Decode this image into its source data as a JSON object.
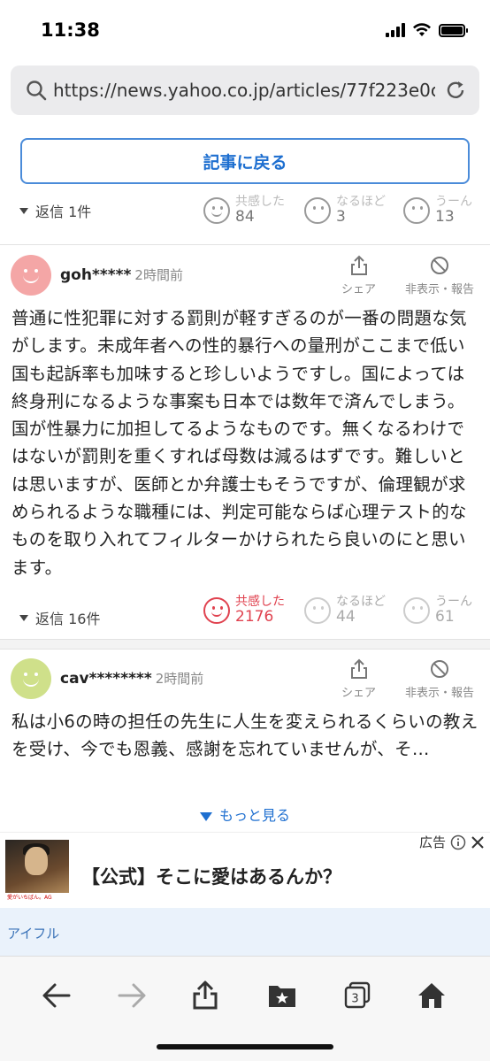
{
  "status": {
    "time": "11:38"
  },
  "url": {
    "text": "https://news.yahoo.co.jp/articles/77f223e0c4..."
  },
  "back_button": {
    "label": "記事に戻る"
  },
  "top_row": {
    "replies": "返信 1件",
    "reactions": [
      {
        "label": "共感した",
        "count": "84"
      },
      {
        "label": "なるほど",
        "count": "3"
      },
      {
        "label": "うーん",
        "count": "13"
      }
    ]
  },
  "comments": [
    {
      "user": "goh*****",
      "time": "2時間前",
      "avatar_color": "#f4a6a6",
      "share_label": "シェア",
      "hide_label": "非表示・報告",
      "body": "普通に性犯罪に対する罰則が軽すぎるのが一番の問題な気がします。未成年者への性的暴行への量刑がここまで低い国も起訴率も加味すると珍しいようですし。国によっては終身刑になるような事案も日本では数年で済んでしまう。国が性暴力に加担してるようなものです。無くなるわけではないが罰則を重くすれば母数は減るはずです。難しいとは思いますが、医師とか弁護士もそうですが、倫理観が求められるような職種には、判定可能ならば心理テスト的なものを取り入れてフィルターかけられたら良いのにと思います。",
      "replies": "返信 16件",
      "reactions": [
        {
          "label": "共感した",
          "count": "2176",
          "active": true
        },
        {
          "label": "なるほど",
          "count": "44"
        },
        {
          "label": "うーん",
          "count": "61"
        }
      ]
    },
    {
      "user": "cav********",
      "time": "2時間前",
      "avatar_color": "#cfe08a",
      "share_label": "シェア",
      "hide_label": "非表示・報告",
      "body": "私は小6の時の担任の先生に人生を変えられるくらいの教えを受け、今でも恩義、感謝を忘れていませんが、そ…",
      "more_label": "もっと見る"
    }
  ],
  "ad": {
    "label": "広告",
    "title": "【公式】そこに愛はあるんか？",
    "sponsor": "アイフル",
    "thumb_caption": "愛がいちばん。AG"
  },
  "colors": {
    "accent": "#1e6fd0",
    "empathy": "#e0424f"
  },
  "toolbar": {
    "icons": [
      "back-arrow-icon",
      "forward-arrow-icon",
      "share-icon",
      "bookmark-star-icon",
      "tabs-icon",
      "home-icon"
    ],
    "tab_count": "3"
  }
}
